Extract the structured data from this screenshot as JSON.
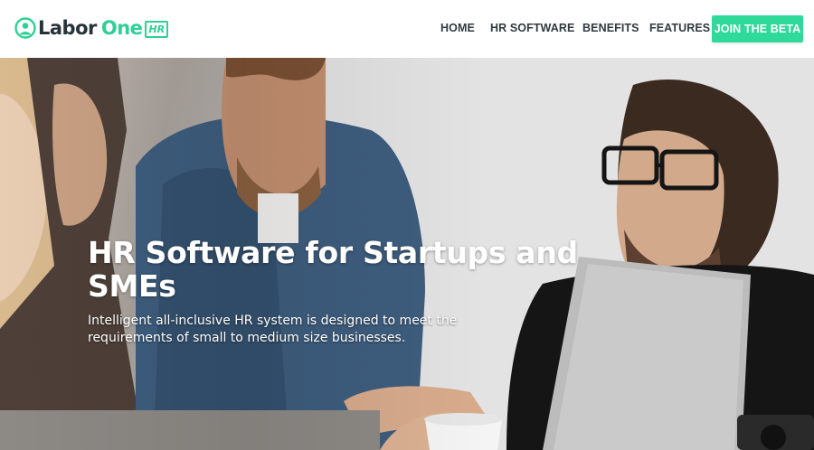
{
  "brand": {
    "name_part1": "Labor",
    "name_part2": "One",
    "badge": "HR",
    "accent_color": "#2fd99a",
    "dark_color": "#26343a"
  },
  "nav": {
    "items": [
      {
        "label": "HOME"
      },
      {
        "label": "HR SOFTWARE"
      },
      {
        "label": "BENEFITS"
      },
      {
        "label": "FEATURES"
      }
    ],
    "cta_label": "JOIN THE BETA"
  },
  "hero": {
    "title": "HR Software for Startups and SMEs",
    "subtitle": "Intelligent all-inclusive HR system is designed to meet the requirements of small to medium size businesses."
  }
}
